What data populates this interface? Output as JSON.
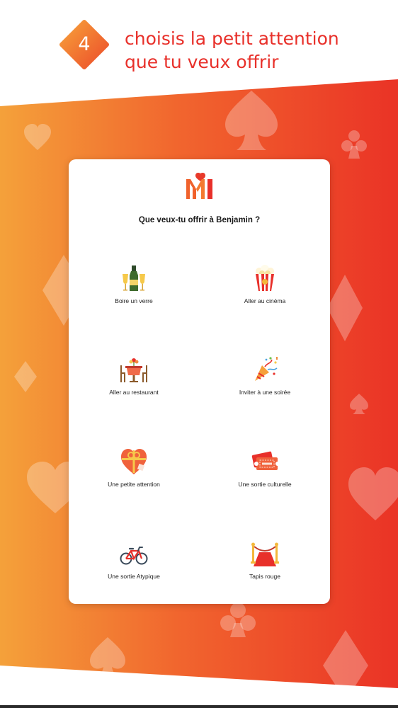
{
  "step": {
    "number": "4",
    "title_line1": "choisis la petit attention",
    "title_line2": "que tu veux offrir"
  },
  "colors": {
    "accent": "#e8302a",
    "gradient_start": "#f4a13a",
    "gradient_end": "#ea3326",
    "badge_light": "#f7a23a",
    "badge_dark": "#ec4c2a"
  },
  "card": {
    "logo_icon": "mi-heart-logo",
    "question": "Que veux-tu offrir à Benjamin ?"
  },
  "options": [
    {
      "label": "Boire un verre",
      "icon": "champagne-icon"
    },
    {
      "label": "Aller au cinéma",
      "icon": "popcorn-icon"
    },
    {
      "label": "Aller au restaurant",
      "icon": "restaurant-icon"
    },
    {
      "label": "Inviter à une soirée",
      "icon": "party-popper-icon"
    },
    {
      "label": "Une petite attention",
      "icon": "gift-heart-icon"
    },
    {
      "label": "Une sortie culturelle",
      "icon": "ticket-icon"
    },
    {
      "label": "Une sortie Atypique",
      "icon": "bicycle-icon"
    },
    {
      "label": "Tapis rouge",
      "icon": "red-carpet-icon"
    }
  ]
}
